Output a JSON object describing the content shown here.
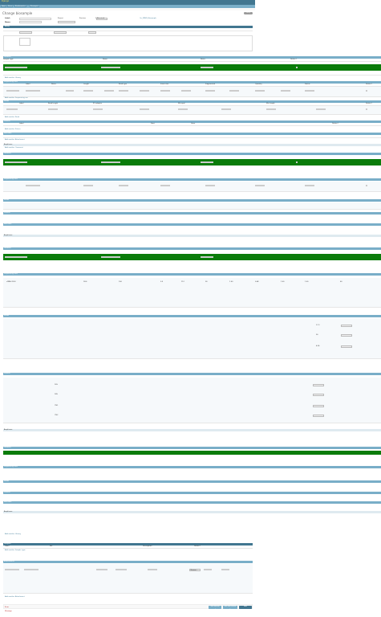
{
  "app": {
    "brand": "Django",
    "breadcrumbs": [
      "Home",
      "Nemo",
      "Bioinformatics",
      "Biosamples"
    ]
  },
  "page": {
    "title": "Change biosample",
    "history": "History"
  },
  "form": {
    "label": "Label:",
    "name": "Name:",
    "project": "Project",
    "preview": "Preview",
    "status": "Status:",
    "status_value": "Received",
    "preview_link": "On_WIND_Biosample"
  },
  "sections": {
    "assay": "Assay",
    "libraries": "Libraries",
    "sequencing_runs": "Sequencing runs",
    "reads": "Reads",
    "primers": "Primers",
    "barcodes": "Barcodes",
    "amplicons": "Amplicons",
    "samples": "Samples",
    "attachments": "Attachments",
    "comments": "Comments",
    "sample_types": "Sample types"
  },
  "columns": {
    "library": [
      "Sample type",
      "Name",
      "Name (text)",
      "Notes",
      "Status",
      "Delete?"
    ],
    "run": [
      "Label",
      "Notes",
      "Name",
      "Length",
      "Read type",
      "Insert size",
      "Fragmented",
      "Quantity",
      "Size",
      "Status",
      "Delete?"
    ],
    "reads": [
      "Label",
      "Name",
      "Read length",
      "Read type",
      "R1 adaptor",
      "R2 adaptor",
      "Min qual",
      "Max qual",
      "Min length",
      "Trim",
      "Delete?"
    ],
    "primers": [
      "Label",
      "Name",
      "Primer seq",
      "Target",
      "Start",
      "End",
      "Gene",
      "Direction",
      "Delete?"
    ],
    "attachments": [
      "Label",
      "Name",
      "File",
      "Description",
      "Uploaded",
      "Delete?"
    ],
    "comments": [
      "Author",
      "Label",
      "Date",
      "Comment",
      "Delete?"
    ]
  },
  "row_values": {
    "sample_type": "cDNA (16S)",
    "run_values": [
      "18.6",
      "100",
      "0.5",
      "112",
      "26",
      "1.00",
      "0.68",
      "1.00",
      "1.00",
      "60"
    ],
    "read_values": [
      "17.3",
      "26",
      "4.96"
    ],
    "primer_names": [
      "16S",
      "18S",
      "ITS1",
      "ITS2"
    ]
  },
  "links": {
    "add_library": "Add another Library",
    "add_run": "Add another Sequencing run",
    "add_read": "Add another Read",
    "add_primer": "Add another Primer",
    "add_attachment": "Add another Attachment",
    "add_comment": "Add another Comment",
    "add_sample_type": "Add another Sample type"
  },
  "errors": {
    "primary": "Error",
    "secondary": "Message"
  },
  "buttons": {
    "save_add": "Save and add another",
    "save_continue": "Save and continue editing",
    "save": "SAVE",
    "browse": "Browse..."
  },
  "colors": {
    "header": "#417690",
    "band": "#79aec8",
    "selected": "#0a7c0a",
    "error": "#ba2121"
  }
}
